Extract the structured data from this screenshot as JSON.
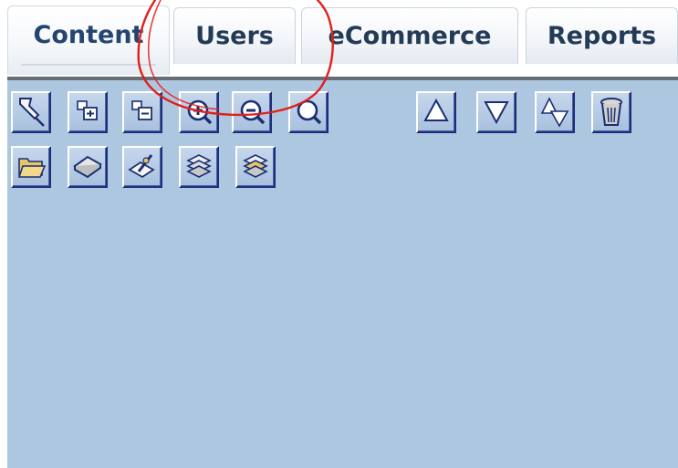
{
  "tabs": [
    {
      "label": "Content",
      "active": true
    },
    {
      "label": "Users",
      "active": false
    },
    {
      "label": "eCommerce",
      "active": false
    },
    {
      "label": "Reports",
      "active": false
    }
  ],
  "toolbar": {
    "row1": [
      "pin-icon",
      "expand-icon",
      "collapse-icon",
      "zoom-in-icon",
      "zoom-out-icon",
      "magnifier-icon",
      "move-up-icon",
      "move-down-icon",
      "sort-icon",
      "trash-icon"
    ],
    "row2": [
      "open-folder-icon",
      "book-icon",
      "edit-icon",
      "book-stack-icon",
      "book-stack-gold-icon"
    ]
  },
  "colors": {
    "panel": "#aec7e0",
    "tab_text": "#243b57",
    "button_border": "#1e2f7a",
    "annotation": "#e0201a"
  }
}
